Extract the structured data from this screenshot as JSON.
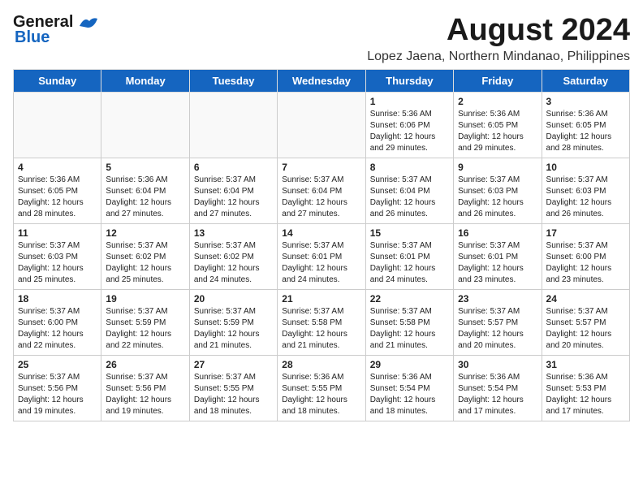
{
  "header": {
    "logo_line1": "General",
    "logo_line2": "Blue",
    "main_title": "August 2024",
    "subtitle": "Lopez Jaena, Northern Mindanao, Philippines"
  },
  "calendar": {
    "weekdays": [
      "Sunday",
      "Monday",
      "Tuesday",
      "Wednesday",
      "Thursday",
      "Friday",
      "Saturday"
    ],
    "weeks": [
      [
        {
          "day": "",
          "info": ""
        },
        {
          "day": "",
          "info": ""
        },
        {
          "day": "",
          "info": ""
        },
        {
          "day": "",
          "info": ""
        },
        {
          "day": "1",
          "info": "Sunrise: 5:36 AM\nSunset: 6:06 PM\nDaylight: 12 hours and 29 minutes."
        },
        {
          "day": "2",
          "info": "Sunrise: 5:36 AM\nSunset: 6:05 PM\nDaylight: 12 hours and 29 minutes."
        },
        {
          "day": "3",
          "info": "Sunrise: 5:36 AM\nSunset: 6:05 PM\nDaylight: 12 hours and 28 minutes."
        }
      ],
      [
        {
          "day": "4",
          "info": "Sunrise: 5:36 AM\nSunset: 6:05 PM\nDaylight: 12 hours and 28 minutes."
        },
        {
          "day": "5",
          "info": "Sunrise: 5:36 AM\nSunset: 6:04 PM\nDaylight: 12 hours and 27 minutes."
        },
        {
          "day": "6",
          "info": "Sunrise: 5:37 AM\nSunset: 6:04 PM\nDaylight: 12 hours and 27 minutes."
        },
        {
          "day": "7",
          "info": "Sunrise: 5:37 AM\nSunset: 6:04 PM\nDaylight: 12 hours and 27 minutes."
        },
        {
          "day": "8",
          "info": "Sunrise: 5:37 AM\nSunset: 6:04 PM\nDaylight: 12 hours and 26 minutes."
        },
        {
          "day": "9",
          "info": "Sunrise: 5:37 AM\nSunset: 6:03 PM\nDaylight: 12 hours and 26 minutes."
        },
        {
          "day": "10",
          "info": "Sunrise: 5:37 AM\nSunset: 6:03 PM\nDaylight: 12 hours and 26 minutes."
        }
      ],
      [
        {
          "day": "11",
          "info": "Sunrise: 5:37 AM\nSunset: 6:03 PM\nDaylight: 12 hours and 25 minutes."
        },
        {
          "day": "12",
          "info": "Sunrise: 5:37 AM\nSunset: 6:02 PM\nDaylight: 12 hours and 25 minutes."
        },
        {
          "day": "13",
          "info": "Sunrise: 5:37 AM\nSunset: 6:02 PM\nDaylight: 12 hours and 24 minutes."
        },
        {
          "day": "14",
          "info": "Sunrise: 5:37 AM\nSunset: 6:01 PM\nDaylight: 12 hours and 24 minutes."
        },
        {
          "day": "15",
          "info": "Sunrise: 5:37 AM\nSunset: 6:01 PM\nDaylight: 12 hours and 24 minutes."
        },
        {
          "day": "16",
          "info": "Sunrise: 5:37 AM\nSunset: 6:01 PM\nDaylight: 12 hours and 23 minutes."
        },
        {
          "day": "17",
          "info": "Sunrise: 5:37 AM\nSunset: 6:00 PM\nDaylight: 12 hours and 23 minutes."
        }
      ],
      [
        {
          "day": "18",
          "info": "Sunrise: 5:37 AM\nSunset: 6:00 PM\nDaylight: 12 hours and 22 minutes."
        },
        {
          "day": "19",
          "info": "Sunrise: 5:37 AM\nSunset: 5:59 PM\nDaylight: 12 hours and 22 minutes."
        },
        {
          "day": "20",
          "info": "Sunrise: 5:37 AM\nSunset: 5:59 PM\nDaylight: 12 hours and 21 minutes."
        },
        {
          "day": "21",
          "info": "Sunrise: 5:37 AM\nSunset: 5:58 PM\nDaylight: 12 hours and 21 minutes."
        },
        {
          "day": "22",
          "info": "Sunrise: 5:37 AM\nSunset: 5:58 PM\nDaylight: 12 hours and 21 minutes."
        },
        {
          "day": "23",
          "info": "Sunrise: 5:37 AM\nSunset: 5:57 PM\nDaylight: 12 hours and 20 minutes."
        },
        {
          "day": "24",
          "info": "Sunrise: 5:37 AM\nSunset: 5:57 PM\nDaylight: 12 hours and 20 minutes."
        }
      ],
      [
        {
          "day": "25",
          "info": "Sunrise: 5:37 AM\nSunset: 5:56 PM\nDaylight: 12 hours and 19 minutes."
        },
        {
          "day": "26",
          "info": "Sunrise: 5:37 AM\nSunset: 5:56 PM\nDaylight: 12 hours and 19 minutes."
        },
        {
          "day": "27",
          "info": "Sunrise: 5:37 AM\nSunset: 5:55 PM\nDaylight: 12 hours and 18 minutes."
        },
        {
          "day": "28",
          "info": "Sunrise: 5:36 AM\nSunset: 5:55 PM\nDaylight: 12 hours and 18 minutes."
        },
        {
          "day": "29",
          "info": "Sunrise: 5:36 AM\nSunset: 5:54 PM\nDaylight: 12 hours and 18 minutes."
        },
        {
          "day": "30",
          "info": "Sunrise: 5:36 AM\nSunset: 5:54 PM\nDaylight: 12 hours and 17 minutes."
        },
        {
          "day": "31",
          "info": "Sunrise: 5:36 AM\nSunset: 5:53 PM\nDaylight: 12 hours and 17 minutes."
        }
      ]
    ]
  }
}
